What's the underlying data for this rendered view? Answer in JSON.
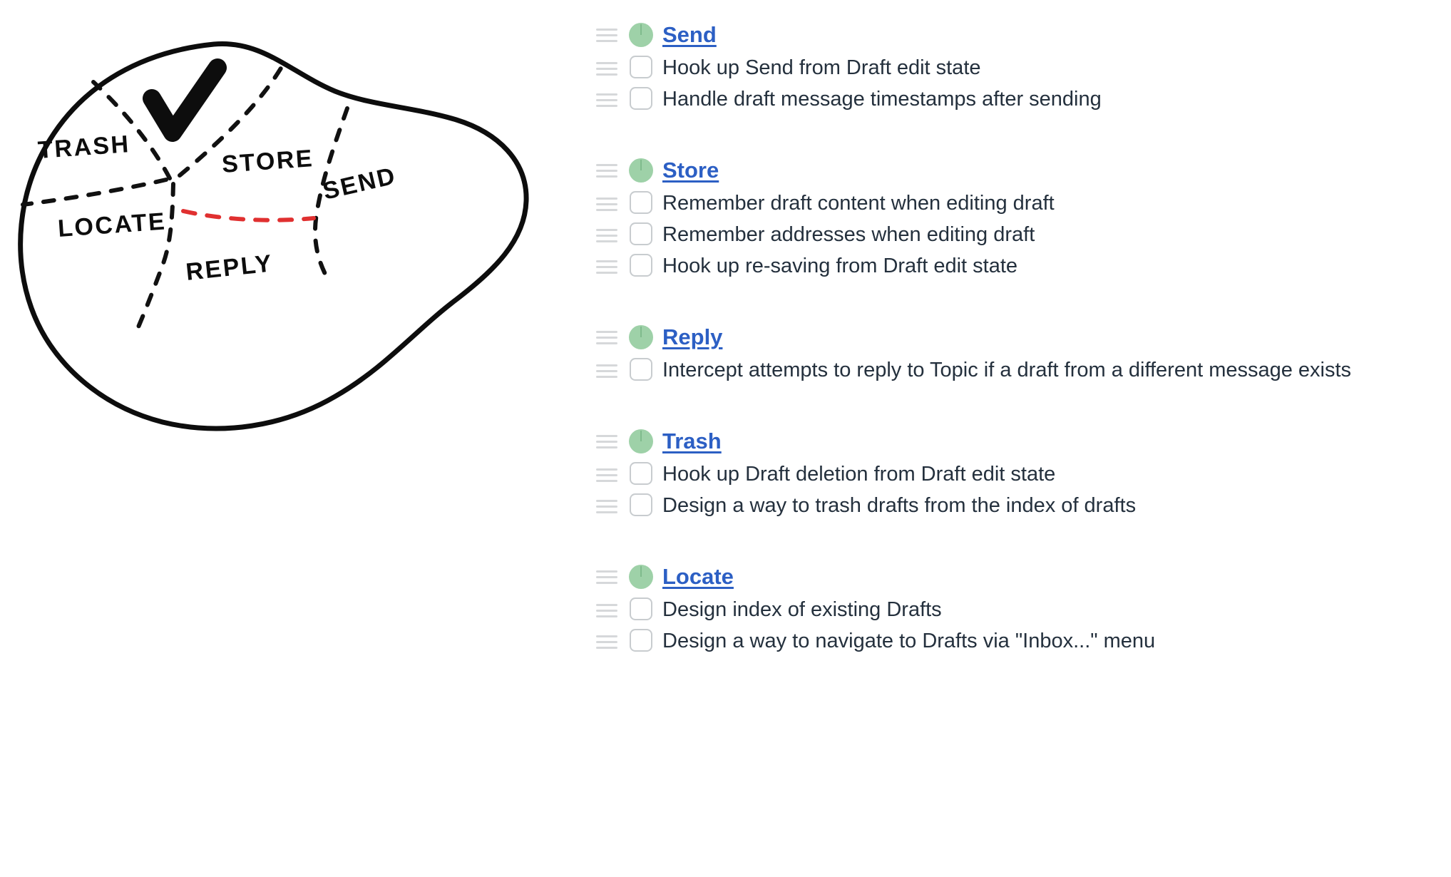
{
  "illustration": {
    "name": "hand-drawn-blob-diagram",
    "checkmark": "✓",
    "regions": [
      {
        "label": "TRASH"
      },
      {
        "label": "STORE"
      },
      {
        "label": "SEND"
      },
      {
        "label": "LOCATE"
      },
      {
        "label": "REPLY"
      }
    ],
    "colors": {
      "outline": "#0d0d0d",
      "divider": "#111111",
      "highlight_divider": "#e03030"
    }
  },
  "checklist": {
    "handle_icon": "drag-handle-icon",
    "groups": [
      {
        "title": "Send",
        "status": "in-progress",
        "tasks": [
          {
            "label": "Hook up Send from Draft edit state",
            "checked": false
          },
          {
            "label": "Handle draft message timestamps after sending",
            "checked": false
          }
        ]
      },
      {
        "title": "Store",
        "status": "in-progress",
        "tasks": [
          {
            "label": "Remember draft content when editing draft",
            "checked": false
          },
          {
            "label": "Remember addresses when editing draft",
            "checked": false
          },
          {
            "label": "Hook up re-saving from Draft edit state",
            "checked": false
          }
        ]
      },
      {
        "title": "Reply",
        "status": "in-progress",
        "tasks": [
          {
            "label": "Intercept attempts to reply to Topic if a draft from a different message exists",
            "checked": false
          }
        ]
      },
      {
        "title": "Trash",
        "status": "in-progress",
        "tasks": [
          {
            "label": "Hook up Draft deletion from Draft edit state",
            "checked": false
          },
          {
            "label": "Design a way to trash drafts from the index of drafts",
            "checked": false
          }
        ]
      },
      {
        "title": "Locate",
        "status": "in-progress",
        "tasks": [
          {
            "label": "Design index of existing Drafts",
            "checked": false
          },
          {
            "label": "Design a way to navigate to Drafts via \"Inbox...\" menu",
            "checked": false
          }
        ]
      }
    ],
    "colors": {
      "link": "#2c5fc4",
      "text": "#24303d",
      "status_green": "#9ed1a8",
      "handle_gray": "#d6d8da",
      "checkbox_border": "#c8cccf"
    }
  }
}
